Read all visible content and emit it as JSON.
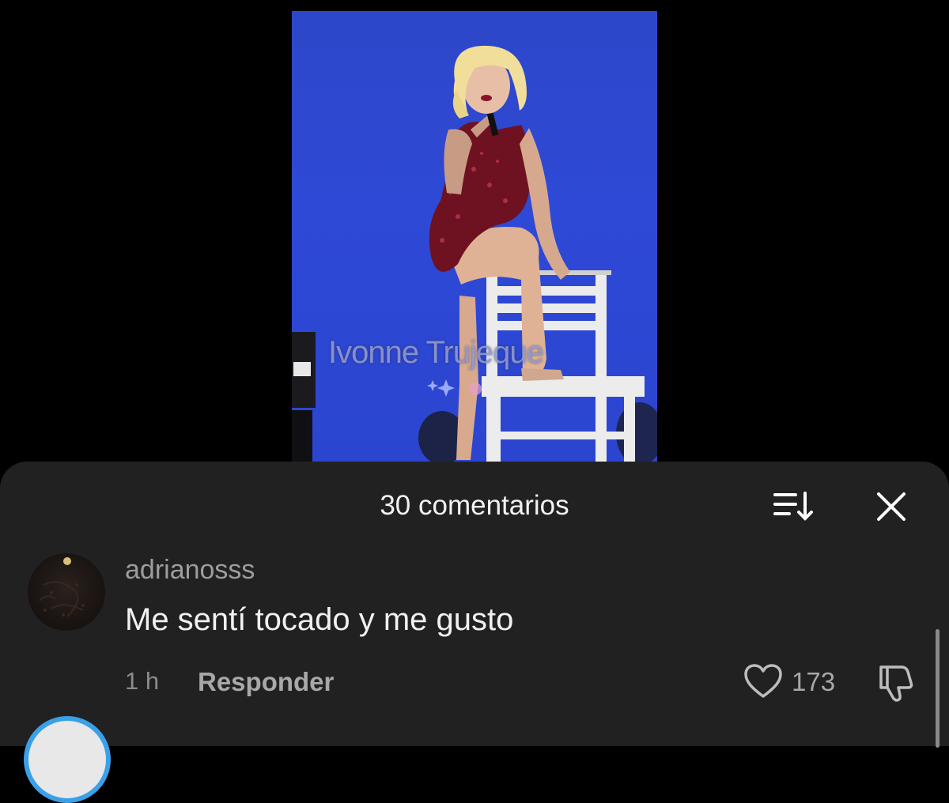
{
  "video": {
    "watermark": "Ivonne Trujeque",
    "background_color": "#2e49d6"
  },
  "comments_sheet": {
    "title": "30 comentarios",
    "sort_icon": "sort-icon",
    "close_icon": "close-icon",
    "comments": [
      {
        "username": "adrianosss",
        "text": "Me sentí tocado y me gusto",
        "time": "1 h",
        "reply_label": "Responder",
        "likes": "173",
        "like_icon": "heart-icon",
        "dislike_icon": "thumbs-down-icon"
      }
    ]
  }
}
